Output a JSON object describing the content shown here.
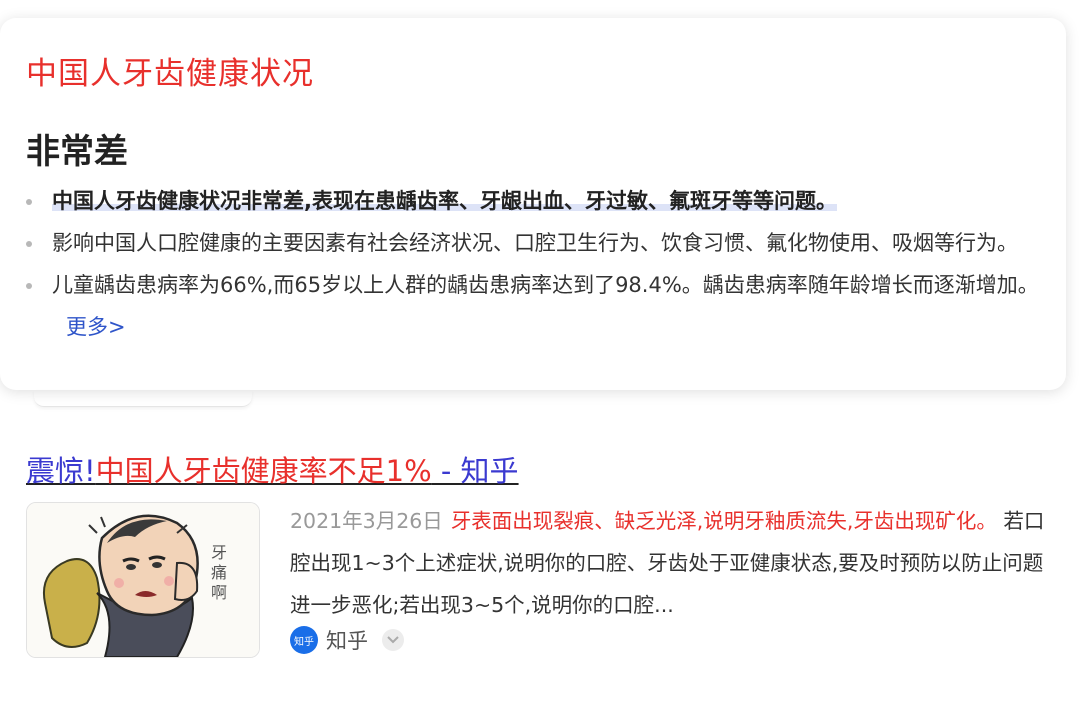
{
  "answer_card": {
    "title": "中国人牙齿健康状况",
    "answer": "非常差",
    "bullets": [
      "中国人牙齿健康状况非常差,表现在患龋齿率、牙龈出血、牙过敏、氟斑牙等等问题。",
      "影响中国人口腔健康的主要因素有社会经济状况、口腔卫生行为、饮食习惯、氟化物使用、吸烟等行为。",
      "儿童龋齿患病率为66%,而65岁以上人群的龋齿患病率达到了98.4%。龋齿患病率随年龄增长而逐渐增加。"
    ],
    "more_label": "更多>"
  },
  "result": {
    "title_part1": "震惊!",
    "title_part2": "中国人牙齿健康率不足1%",
    "title_part3": " - 知乎",
    "thumbnail_caption": "牙痛啊",
    "date": "2021年3月26日",
    "snippet_highlight": "牙表面出现裂痕、缺乏光泽,说明牙釉质流失,牙齿出现矿化。",
    "snippet_text": " 若口腔出现1~3个上述症状,说明你的口腔、牙齿处于亚健康状态,要及时预防以防止问题进一步恶化;若出现3~5个,说明你的口腔...",
    "source_logo_text": "知乎",
    "source_name": "知乎"
  },
  "colors": {
    "title_red": "#e8302c",
    "link_blue": "#3b3ad0",
    "more_blue": "#2f55c9",
    "date_gray": "#999999",
    "zhihu_blue": "#1a6ee8"
  }
}
